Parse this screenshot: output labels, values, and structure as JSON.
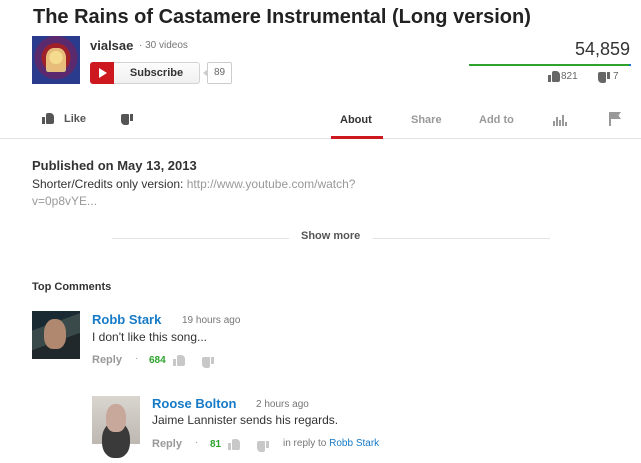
{
  "video": {
    "title": "The Rains of Castamere Instrumental (Long version)",
    "views": "54,859",
    "likes": "821",
    "dislikes": "7",
    "like_ratio": 0.99
  },
  "channel": {
    "name": "vialsae",
    "video_count": "· 30 videos",
    "subscribe_label": "Subscribe",
    "subscriber_count": "89"
  },
  "actions": {
    "like_label": "Like",
    "tabs": [
      {
        "label": "About",
        "active": true
      },
      {
        "label": "Share",
        "active": false
      },
      {
        "label": "Add to",
        "active": false
      }
    ],
    "icons": [
      "stats-icon",
      "flag-icon"
    ]
  },
  "description": {
    "published": "Published on May 13, 2013",
    "text_prefix": "Shorter/Credits only version: ",
    "link_part1": "http://www.youtube.com/watch?",
    "link_part2": "v=0p8vYE...",
    "show_more": "Show more"
  },
  "comments": {
    "heading": "Top Comments",
    "items": [
      {
        "author": "Robb Stark",
        "time": "19 hours ago",
        "text": "I don't like this song...",
        "reply_label": "Reply",
        "dot": "·",
        "likes": "684"
      },
      {
        "author": "Roose Bolton",
        "time": "2 hours ago",
        "text": "Jaime Lannister sends his regards.",
        "reply_label": "Reply",
        "dot": "·",
        "likes": "81",
        "in_reply_prefix": "in reply to ",
        "in_reply_to": "Robb Stark"
      }
    ]
  },
  "colors": {
    "accent_red": "#cc181e",
    "link_blue": "#167ac6",
    "like_green": "#2ea32e"
  }
}
